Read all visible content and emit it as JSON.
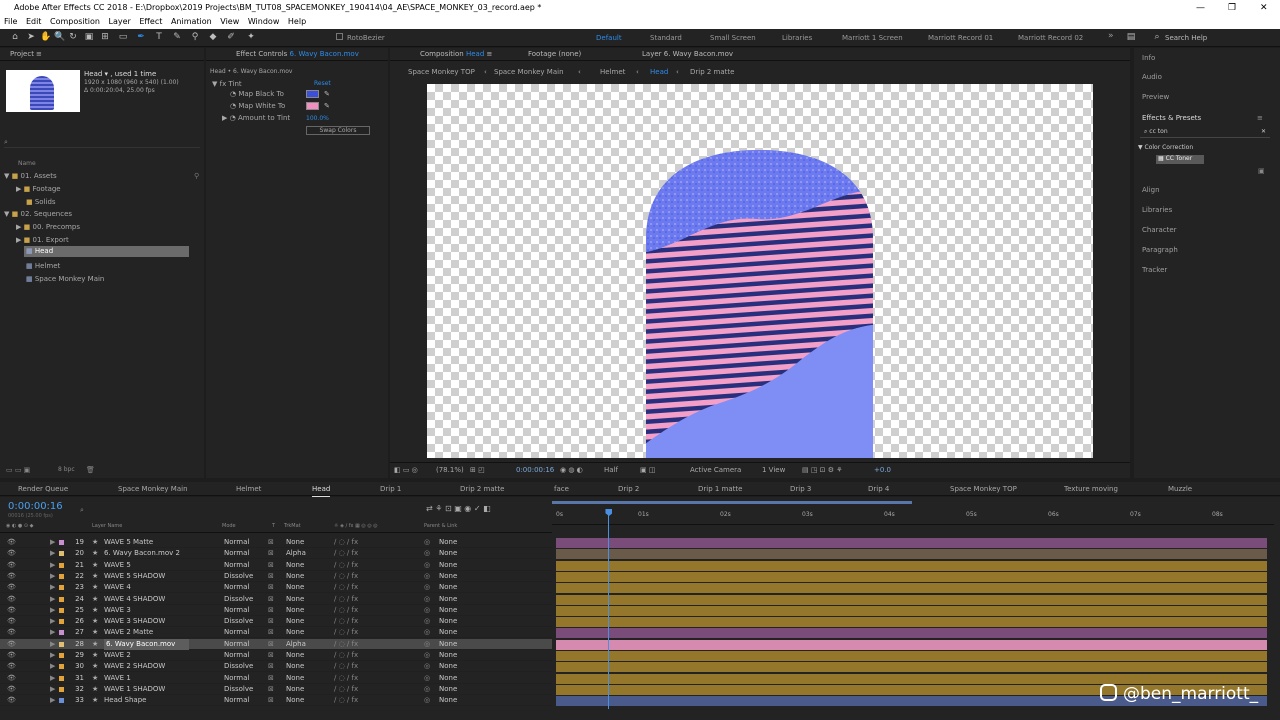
{
  "titlebar": {
    "text": "Adobe After Effects CC 2018 - E:\\Dropbox\\2019 Projects\\BM_TUT08_SPACEMONKEY_190414\\04_AE\\SPACE_MONKEY_03_record.aep *",
    "min": "—",
    "max": "❐",
    "close": "✕"
  },
  "menu": [
    "File",
    "Edit",
    "Composition",
    "Layer",
    "Effect",
    "Animation",
    "View",
    "Window",
    "Help"
  ],
  "toolbar": {
    "rotobezier": "RotoBezier",
    "workspaces": [
      "Default",
      "Standard",
      "Small Screen",
      "Libraries",
      "Marriott 1 Screen",
      "Marriott Record 01",
      "Marriott Record 02"
    ],
    "search_placeholder": "Search Help",
    "more": "»"
  },
  "project": {
    "tab": "Project",
    "menu": "≡",
    "item_name": "Head",
    "used": ", used 1 time",
    "dims": "1920 x 1080  (960 x 540) (1.00)",
    "duration": "Δ 0:00:20:04, 25.00 fps",
    "name_header": "Name",
    "items": [
      {
        "label": "01. Assets",
        "level": 0,
        "open": "▼"
      },
      {
        "label": "Footage",
        "level": 1,
        "open": "▶"
      },
      {
        "label": "Solids",
        "level": 1,
        "open": ""
      },
      {
        "label": "02. Sequences",
        "level": 0,
        "open": "▼"
      },
      {
        "label": "00. Precomps",
        "level": 1,
        "open": "▶"
      },
      {
        "label": "01. Export",
        "level": 1,
        "open": "▶"
      },
      {
        "label": "Head",
        "level": 1,
        "open": ""
      },
      {
        "label": "Helmet",
        "level": 1,
        "open": ""
      },
      {
        "label": "Space Monkey Main",
        "level": 1,
        "open": ""
      }
    ],
    "bpc": "8 bpc"
  },
  "effect_controls": {
    "tab_prefix": "Effect Controls ",
    "tab_layer": "6. Wavy Bacon.mov",
    "subtitle": "Head • 6. Wavy Bacon.mov",
    "effect": "Tint",
    "reset": "Reset",
    "props": [
      "Map Black To",
      "Map White To",
      "Amount to Tint"
    ],
    "amount": "100.0%",
    "swap": "Swap Colors",
    "black_color": "#3b4fd8",
    "white_color": "#f08fc0"
  },
  "viewer": {
    "tab_prefix": "Composition ",
    "tab_comp": "Head",
    "footage": "Footage (none)",
    "layer": "Layer  6. Wavy Bacon.mov",
    "crumbs": [
      "Space Monkey TOP",
      "Space Monkey Main",
      "Helmet",
      "Head",
      "Drip 2 matte"
    ],
    "zoom": "(78.1%)",
    "time": "0:00:00:16",
    "resolution": "Half",
    "camera": "Active Camera",
    "view": "1 View",
    "exposure": "+0.0"
  },
  "right_panel": {
    "info": "Info",
    "audio": "Audio",
    "preview": "Preview",
    "effects_presets": "Effects & Presets",
    "search": "cc ton",
    "category": "Color Correction",
    "result": "CC Toner",
    "items": [
      "Align",
      "Libraries",
      "Character",
      "Paragraph",
      "Tracker"
    ]
  },
  "timeline": {
    "tabs": [
      "Render Queue",
      "Space Monkey Main",
      "Helmet",
      "Head",
      "Drip 1",
      "Drip 2 matte",
      "face",
      "Drip 2",
      "Drip 1 matte",
      "Drip 3",
      "Drip 4",
      "Space Monkey TOP",
      "Texture moving",
      "Muzzle"
    ],
    "timecode": "0:00:00:16",
    "timecode_sub": "00016 (25.00 fps)",
    "col_layer": "Layer Name",
    "col_mode": "Mode",
    "col_t": "T",
    "col_trkmat": "TrkMat",
    "col_parent": "Parent & Link",
    "ruler": [
      "0s",
      "01s",
      "02s",
      "03s",
      "04s",
      "05s",
      "06s",
      "07s",
      "08s"
    ],
    "layers": [
      {
        "n": "19",
        "name": "WAVE 5 Matte",
        "mode": "Normal",
        "trk": "None",
        "parent": "None",
        "label": "#c98fd1",
        "bar": "#7a4c7a"
      },
      {
        "n": "20",
        "name": "6. Wavy Bacon.mov 2",
        "mode": "Normal",
        "trk": "Alpha",
        "parent": "None",
        "label": "#e0c070",
        "bar": "#6a5a4a"
      },
      {
        "n": "21",
        "name": "WAVE 5",
        "mode": "Normal",
        "trk": "None",
        "parent": "None",
        "label": "#e3a33b",
        "bar": "#94772a"
      },
      {
        "n": "22",
        "name": "WAVE 5 SHADOW",
        "mode": "Dissolve",
        "trk": "None",
        "parent": "None",
        "label": "#e3a33b",
        "bar": "#94772a"
      },
      {
        "n": "23",
        "name": "WAVE 4",
        "mode": "Normal",
        "trk": "None",
        "parent": "None",
        "label": "#e3a33b",
        "bar": "#94772a"
      },
      {
        "n": "24",
        "name": "WAVE 4 SHADOW",
        "mode": "Dissolve",
        "trk": "None",
        "parent": "None",
        "label": "#e3a33b",
        "bar": "#94772a"
      },
      {
        "n": "25",
        "name": "WAVE 3",
        "mode": "Normal",
        "trk": "None",
        "parent": "None",
        "label": "#e3a33b",
        "bar": "#94772a"
      },
      {
        "n": "26",
        "name": "WAVE 3 SHADOW",
        "mode": "Dissolve",
        "trk": "None",
        "parent": "None",
        "label": "#e3a33b",
        "bar": "#94772a"
      },
      {
        "n": "27",
        "name": "WAVE 2 Matte",
        "mode": "Normal",
        "trk": "None",
        "parent": "None",
        "label": "#c98fd1",
        "bar": "#7a4c7a"
      },
      {
        "n": "28",
        "name": "6. Wavy Bacon.mov",
        "mode": "Normal",
        "trk": "Alpha",
        "parent": "None",
        "label": "#e0c070",
        "bar": "#d68ab0"
      },
      {
        "n": "29",
        "name": "WAVE 2",
        "mode": "Normal",
        "trk": "None",
        "parent": "None",
        "label": "#e3a33b",
        "bar": "#94772a"
      },
      {
        "n": "30",
        "name": "WAVE 2 SHADOW",
        "mode": "Dissolve",
        "trk": "None",
        "parent": "None",
        "label": "#e3a33b",
        "bar": "#94772a"
      },
      {
        "n": "31",
        "name": "WAVE 1",
        "mode": "Normal",
        "trk": "None",
        "parent": "None",
        "label": "#e3a33b",
        "bar": "#94772a"
      },
      {
        "n": "32",
        "name": "WAVE 1 SHADOW",
        "mode": "Dissolve",
        "trk": "None",
        "parent": "None",
        "label": "#e3a33b",
        "bar": "#94772a"
      },
      {
        "n": "33",
        "name": "Head Shape",
        "mode": "Normal",
        "trk": "None",
        "parent": "None",
        "label": "#6b8fd6",
        "bar": "#4a5a8a"
      }
    ],
    "selected_row": 9,
    "playhead_fraction": 0.08
  },
  "watermark": "@ben_marriott_"
}
